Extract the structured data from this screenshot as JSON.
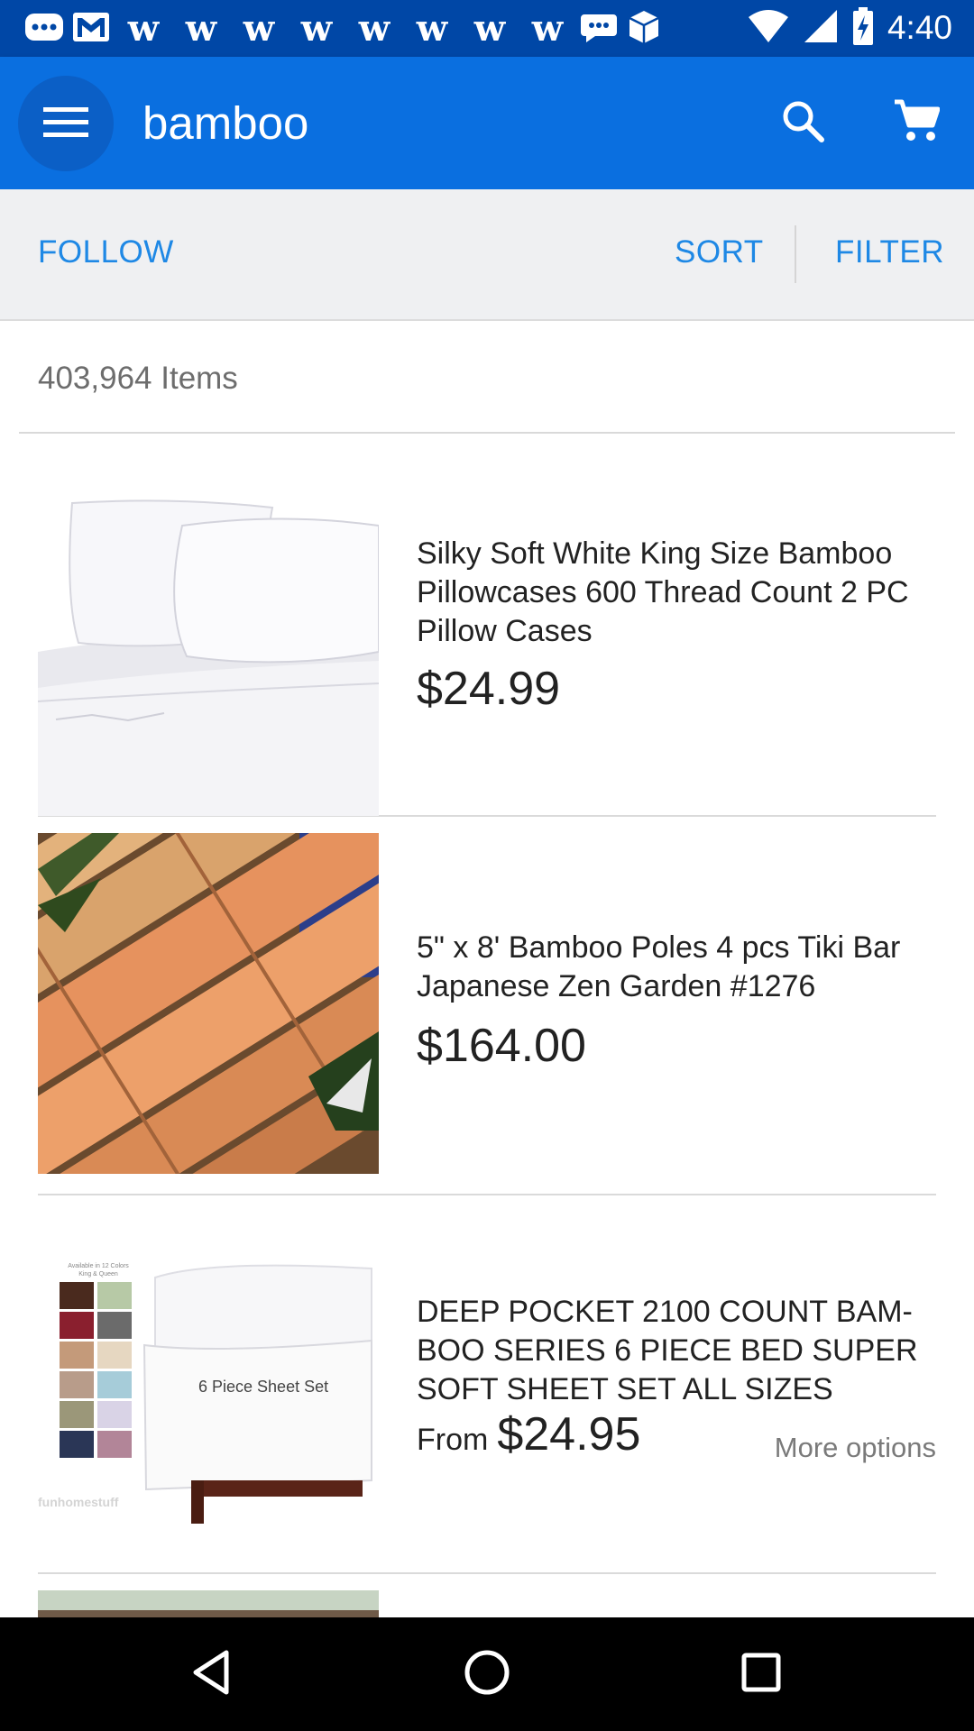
{
  "status_bar": {
    "time": "4:40",
    "notification_icons": [
      "message-icon",
      "gmail-icon",
      "w-app-icon",
      "w-app-icon",
      "w-app-icon",
      "w-app-icon",
      "w-app-icon",
      "w-app-icon",
      "w-app-icon",
      "w-app-icon",
      "chat-bubble-icon",
      "package-icon"
    ],
    "w_glyph": "w",
    "system_icons": [
      "wifi-icon",
      "signal-icon",
      "battery-charging-icon"
    ]
  },
  "app_bar": {
    "query": "bamboo",
    "icons": [
      "menu-icon",
      "search-icon",
      "cart-icon"
    ]
  },
  "actions": {
    "follow": "FOLLOW",
    "sort": "SORT",
    "filter": "FILTER"
  },
  "results": {
    "count_label": "403,964 Items"
  },
  "listings": [
    {
      "title": "Silky Soft White King Size Bamboo Pillowcases 600 Thread Count 2 PC Pillow Cases",
      "price": "$24.99"
    },
    {
      "title": "5\" x 8' Bamboo Poles 4 pcs Tiki Bar Japanese Zen Garden #1276",
      "price": "$164.00"
    },
    {
      "title": "DEEP POCKET 2100 COUNT BAM-BOO SERIES 6 PIECE BED SUPER SOFT SHEET SET ALL SIZES",
      "price_prefix": "From",
      "price": "$24.95",
      "more_options": "More options",
      "image_text": {
        "caption": "6 Piece Sheet Set",
        "swatch_header": "Available in 12 Colors\nKing & Queen",
        "watermark": "funhomestuff"
      }
    }
  ],
  "colors": {
    "status_bar": "#0047a6",
    "app_bar": "#0a6fe0",
    "accent_text": "#1e88e5"
  },
  "nav_bar": {
    "icons": [
      "back-icon",
      "home-icon",
      "recents-icon"
    ]
  }
}
